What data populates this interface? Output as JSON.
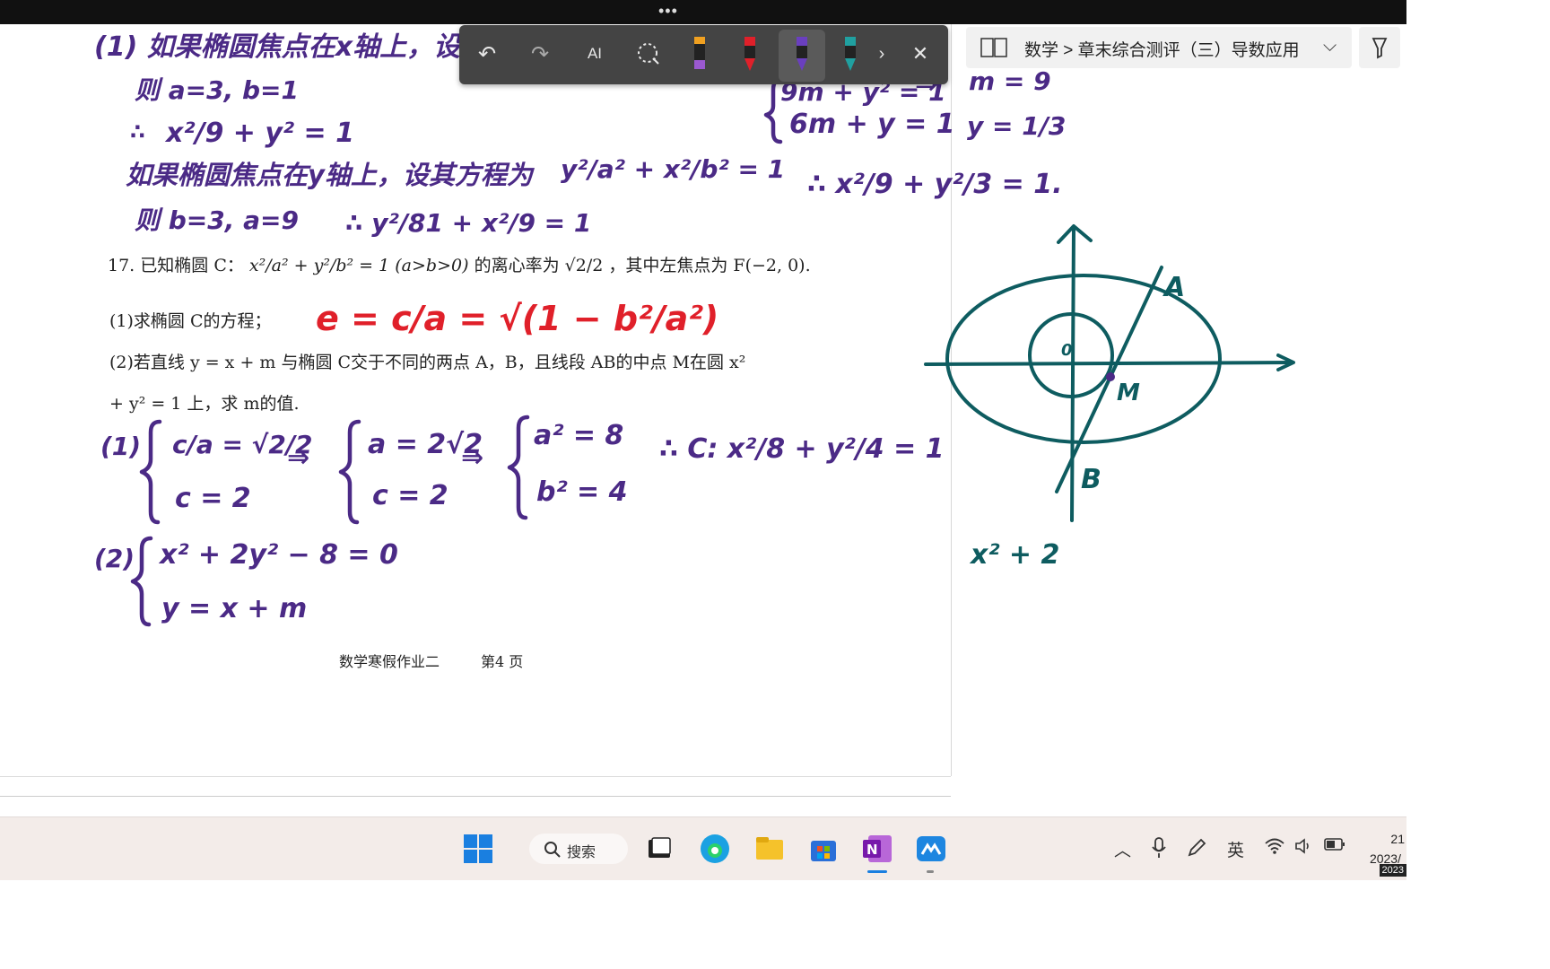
{
  "pen_toolbar": {
    "tools": [
      {
        "name": "undo-icon"
      },
      {
        "name": "redo-icon"
      },
      {
        "name": "ink-to-text-icon",
        "label": "AI"
      },
      {
        "name": "lasso-select-icon"
      },
      {
        "name": "pen-black-orange-icon"
      },
      {
        "name": "pen-red-icon"
      },
      {
        "name": "pen-purple-icon"
      },
      {
        "name": "pen-teal-icon"
      },
      {
        "name": "next-icon"
      },
      {
        "name": "close-icon"
      }
    ],
    "colors": {
      "background": "#444444",
      "red": "#e0202a",
      "purple": "#4b2a86",
      "teal": "#0e5c60"
    }
  },
  "breadcrumb": {
    "text": "数学 > 章末综合测评（三）导数应用"
  },
  "problem": {
    "number": "17.",
    "stem_prefix": "已知椭圆",
    "stem_c": "C：",
    "stem_eq": "x²/a² + y²/b² = 1 (a>b>0)",
    "stem_mid": "的离心率为",
    "stem_frac": "√2/2",
    "stem_suffix": "，其中左焦点为 F(−2, 0).",
    "q1": "(1)求椭圆 C的方程；",
    "q2a": "(2)若直线 y = x + m 与椭圆 C交于不同的两点 A，B，且线段 AB的中点 M在圆 x²",
    "q2b": "+ y² = 1 上，求 m的值."
  },
  "footer": {
    "title": "数学寒假作业二",
    "page": "第4 页"
  },
  "ink": {
    "l1": "(1) 如果椭圆焦点在x轴上，设其",
    "l2": "则 a=3, b=1",
    "l3a": "∴",
    "l3b": "x²/9 + y² = 1",
    "l4": "如果椭圆焦点在y轴上，设其方程为",
    "l4eq": "y²/a² + x²/b² = 1",
    "l5": "则 b=3, a=9",
    "l5eq": "∴ y²/81 + x²/9 = 1",
    "red": "e = c/a = √(1 − b²/a²)",
    "s1_label": "(1)",
    "s1_a": "c/a = √2/2",
    "s1_b": "c = 2",
    "s1_c": "a = 2√2",
    "s1_d": "c = 2",
    "s1_e": "a² = 8",
    "s1_f": "b² = 4",
    "s1_res": "∴ C: x²/8 + y²/4 = 1",
    "s2_label": "(2)",
    "s2_a": "x² + 2y² − 8 = 0",
    "s2_b": "y = x + m",
    "r1": "9m + y² = 1",
    "r2": "6m + y = 1",
    "r3": "m = 9",
    "r4": "y = 1/3",
    "r5": "∴ x²/9 + y²/3 = 1.",
    "diag_A": "A",
    "diag_B": "B",
    "diag_M": "M",
    "diag_O": "0",
    "diag_expr": "x² + 2"
  },
  "taskbar": {
    "search_label": "搜索",
    "ime": "英",
    "time": "21",
    "date": "2023/",
    "notif": "2023"
  }
}
